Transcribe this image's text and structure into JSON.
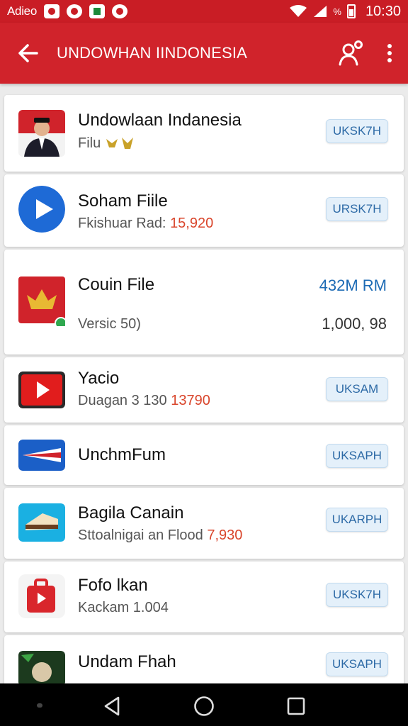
{
  "status_bar": {
    "carrier": "Adieo",
    "battery_pct": "%",
    "time": "10:30"
  },
  "app_bar": {
    "title": "UNDOWHAN IINDONESIA"
  },
  "items": [
    {
      "title": "Undowlaan Indanesia",
      "subtitle": "Filu",
      "subtitle_num": "",
      "action": "UKSK7H"
    },
    {
      "title": "Soham Fiile",
      "subtitle": "Fkishuar Rad:",
      "subtitle_num": "15,920",
      "action": "URSK7H"
    },
    {
      "title": "Couin File",
      "subtitle": "Versic 50)",
      "subtitle_num": "",
      "size": "432M RM",
      "count": "1,000, 98"
    },
    {
      "title": "Yacio",
      "subtitle": "Duagan 3 130",
      "subtitle_num": "13790",
      "action": "UKSAM"
    },
    {
      "title": "UnchmFum",
      "subtitle": "",
      "subtitle_num": "",
      "action": "UKSAPH"
    },
    {
      "title": "Bagila Canain",
      "subtitle": "Sttoalnigai  an Flood",
      "subtitle_num": "7,930",
      "action": "UKARPH"
    },
    {
      "title": "Fofo lkan",
      "subtitle": "Kackam 1.004",
      "subtitle_num": "",
      "action": "UKSK7H"
    },
    {
      "title": "Undam Fhah",
      "subtitle": "",
      "subtitle_num": "",
      "action": "UKSAPH"
    }
  ],
  "icons": {
    "back": "arrow-left-icon",
    "user": "user-search-icon",
    "more": "more-vert-icon",
    "nav_back": "triangle-back-icon",
    "nav_home": "circle-home-icon",
    "nav_recent": "square-recent-icon"
  },
  "colors": {
    "accent": "#d0232b",
    "status": "#c91d25",
    "pill_text": "#2d6aa6",
    "highlight_num": "#d9452b",
    "size_text": "#1d6bb5"
  }
}
